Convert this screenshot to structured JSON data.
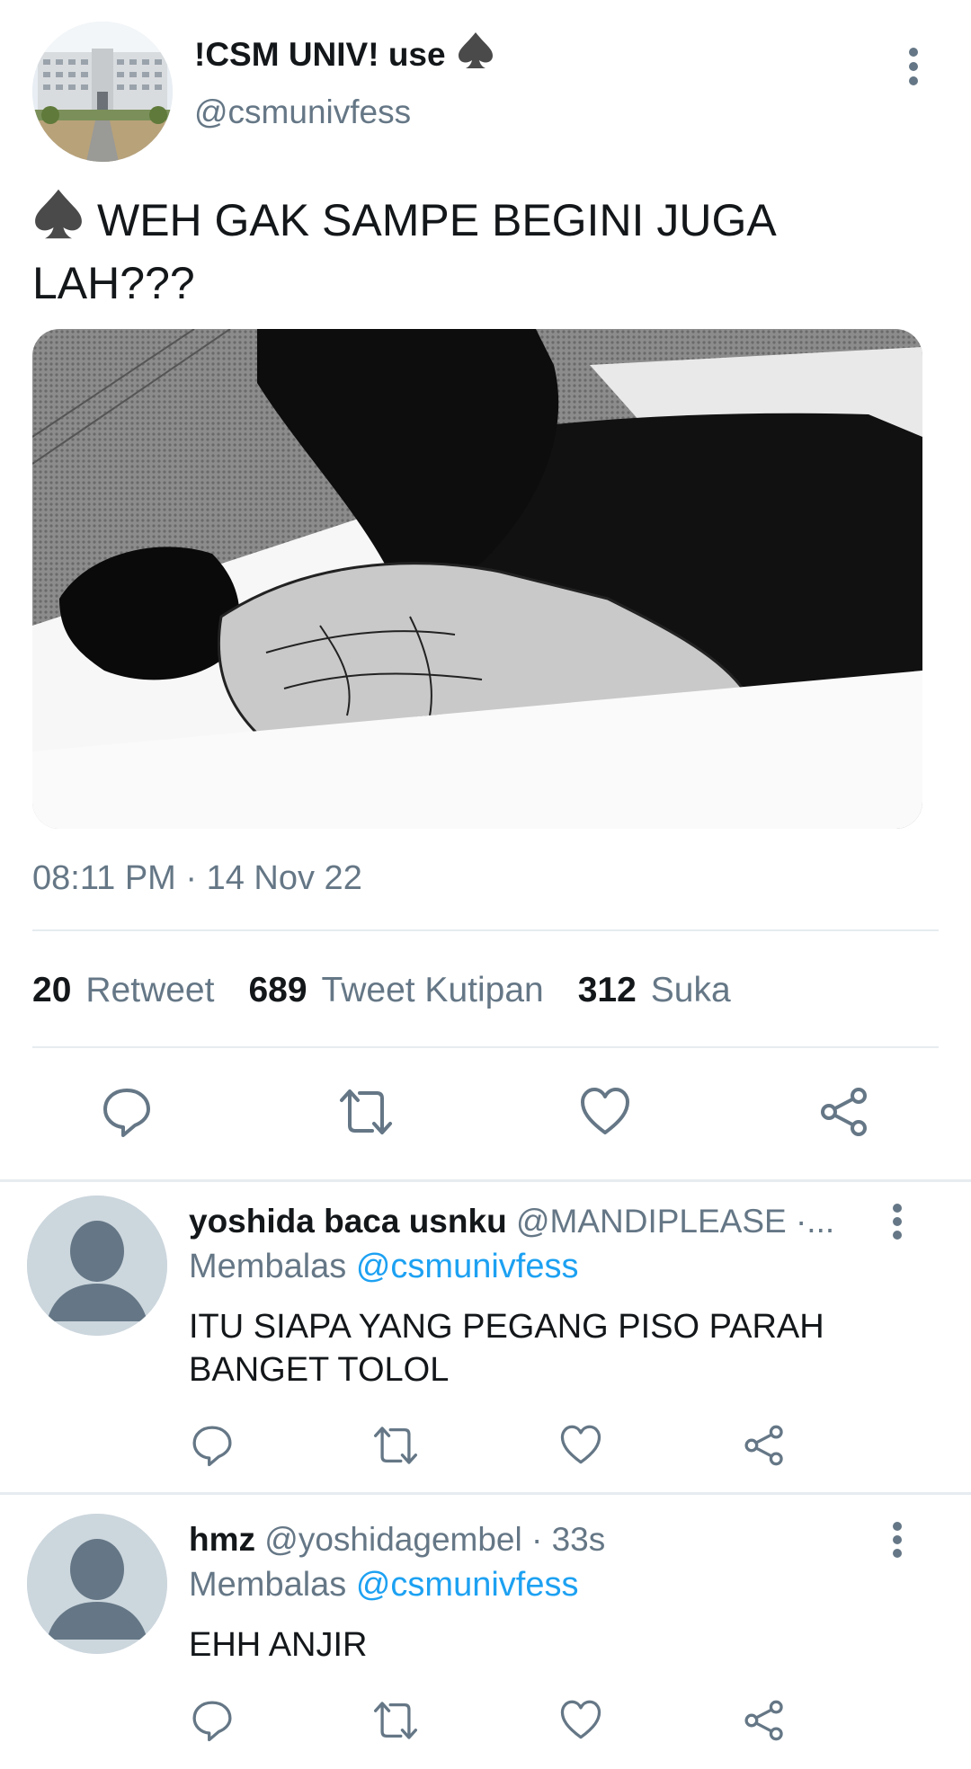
{
  "tweet": {
    "display_name": "!CSM UNIV! use",
    "handle": "@csmunivfess",
    "text": "WEH GAK SAMPE BEGINI JUGA LAH???",
    "timestamp": "08:11 PM · 14 Nov 22",
    "stats": [
      {
        "count": "20",
        "label": "Retweet"
      },
      {
        "count": "689",
        "label": "Tweet Kutipan"
      },
      {
        "count": "312",
        "label": "Suka"
      }
    ]
  },
  "replies": [
    {
      "name": "yoshida baca usnku",
      "meta": "@MANDIPLEASE ·...",
      "replying_prefix": "Membalas",
      "replying_to": "@csmunivfess",
      "text": "ITU SIAPA YANG PEGANG PISO PARAH BANGET TOLOL"
    },
    {
      "name": "hmz",
      "meta": "@yoshidagembel · 33s",
      "replying_prefix": "Membalas",
      "replying_to": "@csmunivfess",
      "text": "EHH ANJIR"
    }
  ],
  "icons": {
    "more": "more-vertical-icon",
    "reply": "reply-icon",
    "retweet": "retweet-icon",
    "like": "heart-icon",
    "share": "share-icon",
    "spade": "spade-icon"
  },
  "colors": {
    "text": "#14171a",
    "muted": "#657786",
    "link": "#1da1f2",
    "divider": "#e6ecf0"
  }
}
